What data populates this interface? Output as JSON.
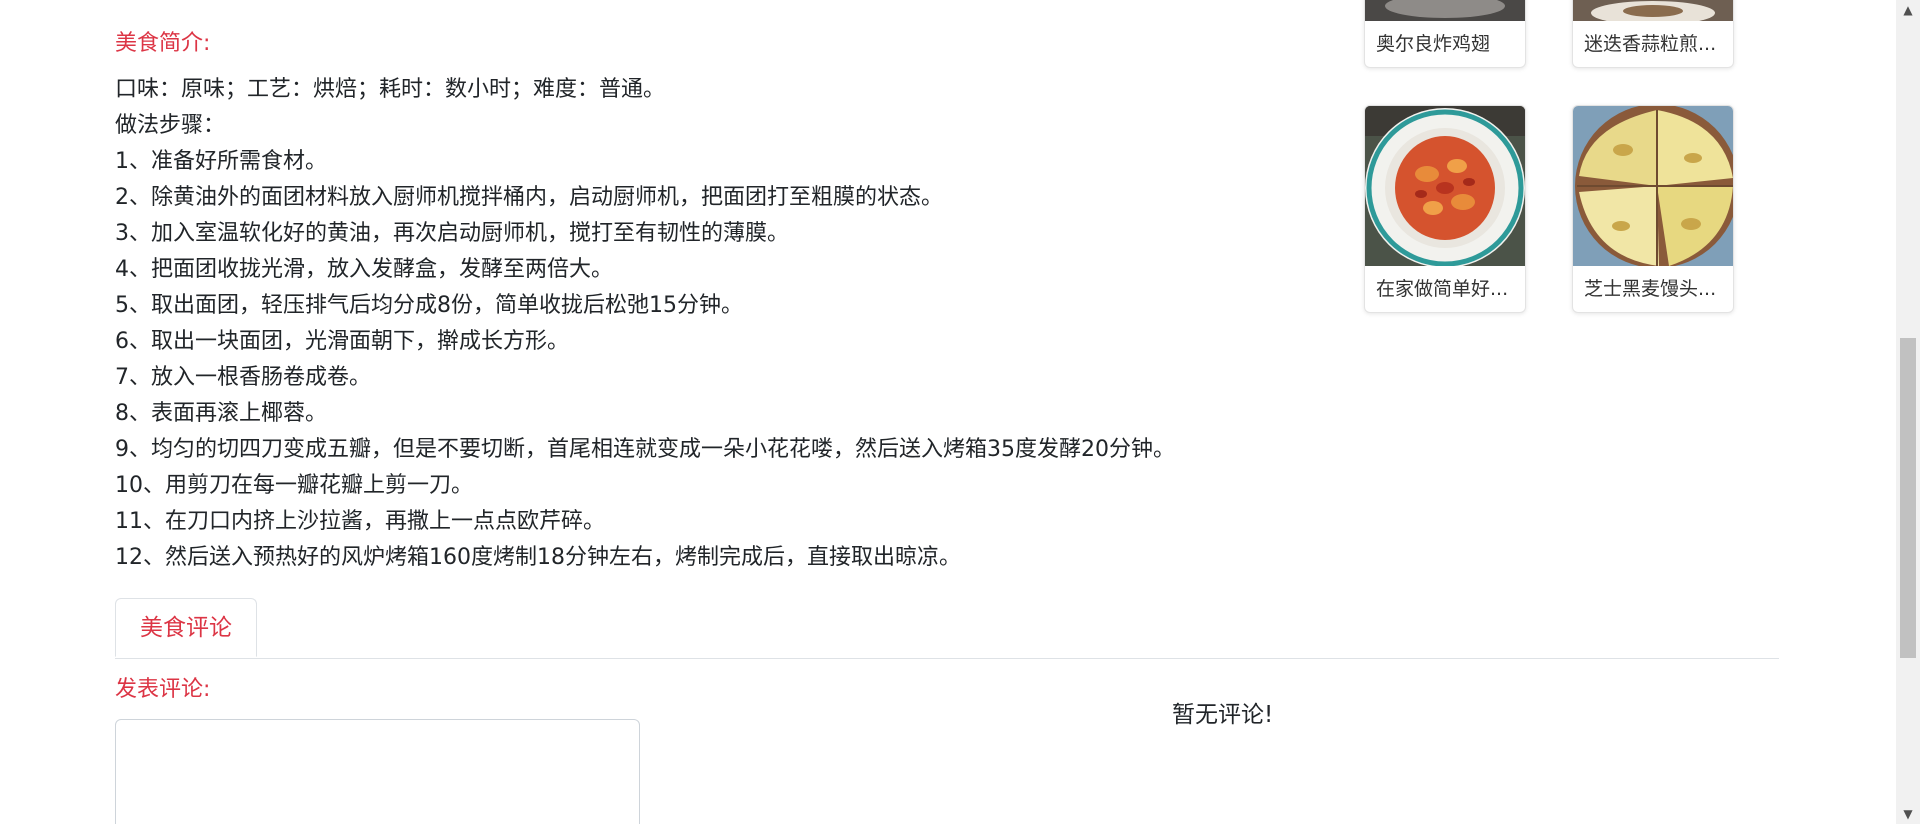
{
  "intro": {
    "title": "美食简介:",
    "lines": [
      "口味：原味；工艺：烘焙；耗时：数小时；难度：普通。",
      "做法步骤：",
      "1、准备好所需食材。",
      "2、除黄油外的面团材料放入厨师机搅拌桶内，启动厨师机，把面团打至粗膜的状态。",
      "3、加入室温软化好的黄油，再次启动厨师机，搅打至有韧性的薄膜。",
      "4、把面团收拢光滑，放入发酵盒，发酵至两倍大。",
      "5、取出面团，轻压排气后均分成8份，简单收拢后松弛15分钟。",
      "6、取出一块面团，光滑面朝下，擀成长方形。",
      "7、放入一根香肠卷成卷。",
      "8、表面再滚上椰蓉。",
      "9、均匀的切四刀变成五瓣，但是不要切断，首尾相连就变成一朵小花花喽，然后送入烤箱35度发酵20分钟。",
      "10、用剪刀在每一瓣花瓣上剪一刀。",
      "11、在刀口内挤上沙拉酱，再撒上一点点欧芹碎。",
      "12、然后送入预热好的风炉烤箱160度烤制18分钟左右，烤制完成后，直接取出晾凉。"
    ]
  },
  "tabs": {
    "comments_label": "美食评论"
  },
  "comments": {
    "post_title": "发表评论:",
    "textarea_placeholder": "",
    "empty_text": "暂无评论!"
  },
  "related": [
    {
      "title": "奥尔良炸鸡翅"
    },
    {
      "title": "迷迭香蒜粒煎..."
    },
    {
      "title": "在家做简单好..."
    },
    {
      "title": "芝士黑麦馒头..."
    }
  ],
  "colors": {
    "accent": "#dc3545",
    "text": "#212529"
  },
  "icons": {
    "scroll_up": "scroll-up-arrow-icon",
    "scroll_down": "scroll-down-arrow-icon"
  }
}
